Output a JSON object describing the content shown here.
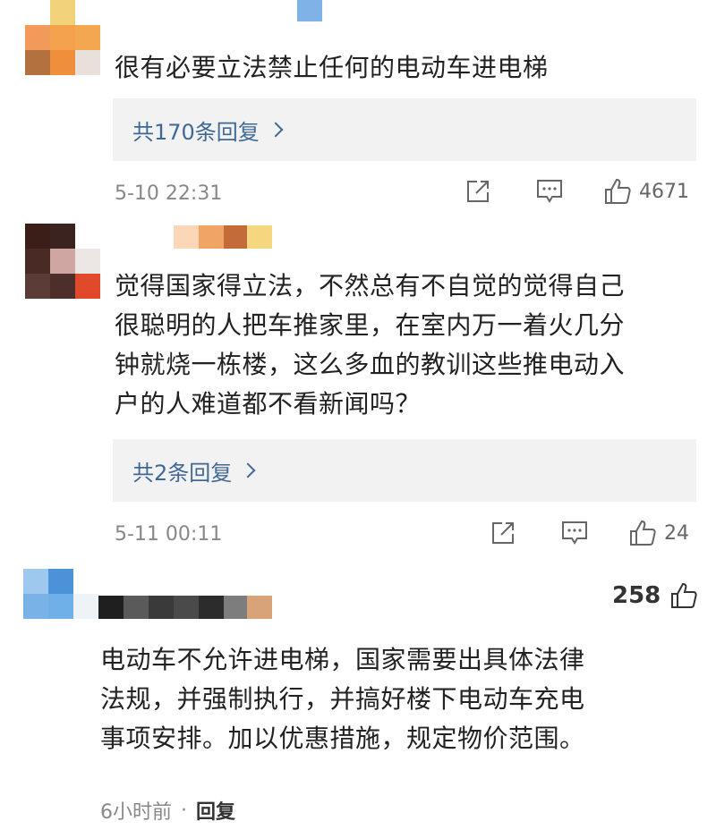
{
  "comments": [
    {
      "text": "很有必要立法禁止任何的电动车进电梯",
      "reply_count_label": "共170条回复",
      "time": "5-10 22:31",
      "likes": "4671"
    },
    {
      "text_lines": [
        "觉得国家得立法，不然总有不自觉的觉得自己",
        "很聪明的人把车推家里，在室内万一着火几分",
        "钟就烧一栋楼，这么多血的教训这些推电动入",
        "户的人难道都不看新闻吗？"
      ],
      "reply_count_label": "共2条回复",
      "time": "5-11 00:11",
      "likes": "24"
    },
    {
      "text_lines": [
        "电动车不允许进电梯，国家需要出具体法律",
        "法规，并强制执行，并搞好楼下电动车充电",
        "事项安排。加以优惠措施，规定物价范围。"
      ],
      "likes": "258",
      "time": "6小时前",
      "dot": "·",
      "reply_label": "回复"
    }
  ],
  "colors": {
    "link": "#3f6896",
    "reply_bg": "#f2f2f2",
    "meta_text": "#888888"
  },
  "icons": [
    "share-icon",
    "comment-icon",
    "like-icon"
  ]
}
